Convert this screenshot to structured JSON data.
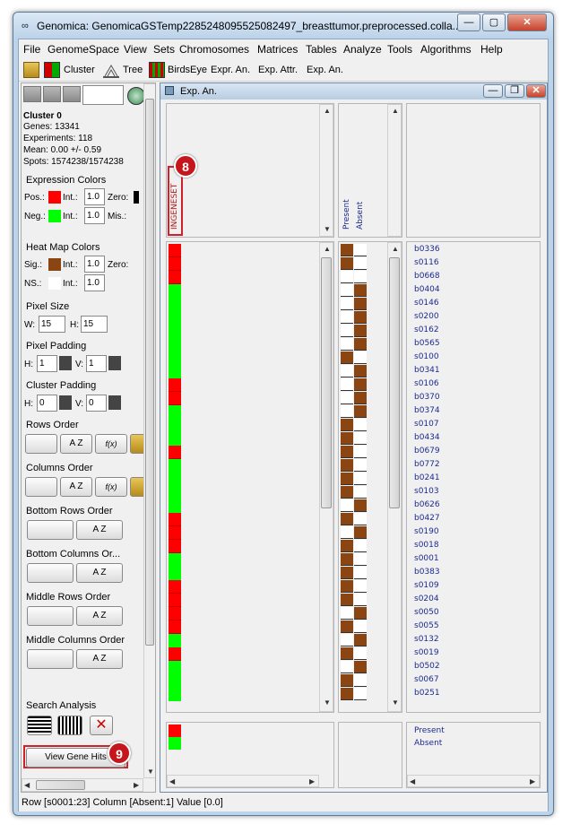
{
  "window": {
    "title": "Genomica: GenomicaGSTemp2285248095525082497_breasttumor.preprocessed.colla...",
    "minimize": "—",
    "maximize": "▢",
    "close": "✕"
  },
  "menu": [
    "File",
    "GenomeSpace",
    "View",
    "Sets",
    "Chromosomes",
    "Matrices",
    "Tables",
    "Analyze",
    "Tools",
    "Algorithms",
    "Help"
  ],
  "toolbar": {
    "cluster": "Cluster",
    "tree": "Tree",
    "birdseye": "BirdsEye",
    "expr_an": "Expr. An.",
    "exp_attr": "Exp. Attr.",
    "exp_an": "Exp. An."
  },
  "cluster_info": {
    "name": "Cluster 0",
    "genes": "Genes: 13341",
    "experiments": "Experiments: 118",
    "mean": "Mean: 0.00 +/- 0.59",
    "spots": "Spots: 1574238/1574238"
  },
  "expression_colors": {
    "title": "Expression Colors",
    "pos": "Pos.:",
    "neg": "Neg.:",
    "int": "Int.:",
    "zero": "Zero:",
    "mis": "Mis.:",
    "pos_int": "1.0",
    "neg_int": "1.0",
    "pos_color": "#ff0000",
    "neg_color": "#00ff00",
    "zero_color": "#000000"
  },
  "heatmap_colors": {
    "title": "Heat Map Colors",
    "sig": "Sig.:",
    "ns": "NS.:",
    "int": "Int.:",
    "zero": "Zero:",
    "sig_int": "1.0",
    "ns_int": "1.0",
    "sig_color": "#8b4513",
    "ns_color": "#ffffff"
  },
  "pixel_size": {
    "title": "Pixel Size",
    "w_label": "W:",
    "h_label": "H:",
    "w": "15",
    "h": "15"
  },
  "pixel_padding": {
    "title": "Pixel Padding",
    "h_label": "H:",
    "v_label": "V:",
    "h": "1",
    "v": "1"
  },
  "cluster_padding": {
    "title": "Cluster Padding",
    "h_label": "H:",
    "v_label": "V:",
    "h": "0",
    "v": "0"
  },
  "rows_order": {
    "title": "Rows Order"
  },
  "columns_order": {
    "title": "Columns Order"
  },
  "bottom_rows_order": {
    "title": "Bottom Rows Order"
  },
  "bottom_columns_order": {
    "title": "Bottom Columns Or..."
  },
  "middle_rows_order": {
    "title": "Middle Rows Order"
  },
  "middle_columns_order": {
    "title": "Middle Columns Order"
  },
  "search_analysis": {
    "title": "Search Analysis"
  },
  "view_gene_hits": "View Gene Hits",
  "internal_frame": {
    "title": "Exp. An."
  },
  "column_header": "INGENESET",
  "attr_columns": [
    "Present",
    "Absent"
  ],
  "row_labels": [
    "b0336",
    "s0116",
    "b0668",
    "b0404",
    "s0146",
    "s0200",
    "s0162",
    "b0565",
    "s0100",
    "b0341",
    "s0106",
    "b0370",
    "b0374",
    "s0107",
    "b0434",
    "b0679",
    "b0772",
    "b0241",
    "s0103",
    "b0626",
    "b0427",
    "s0190",
    "s0018",
    "s0001",
    "b0383",
    "s0109",
    "s0204",
    "s0050",
    "s0055",
    "s0132",
    "s0019",
    "b0502",
    "s0067",
    "b0251"
  ],
  "heat_column": [
    "r",
    "r",
    "r",
    "g",
    "g",
    "g",
    "g",
    "g",
    "g",
    "g",
    "r",
    "r",
    "g",
    "g",
    "g",
    "r",
    "g",
    "g",
    "g",
    "g",
    "r",
    "r",
    "r",
    "g",
    "g",
    "r",
    "r",
    "r",
    "r",
    "g",
    "r",
    "g",
    "g",
    "g"
  ],
  "attr_matrix": [
    [
      1,
      0
    ],
    [
      1,
      0
    ],
    [
      0,
      0
    ],
    [
      0,
      1
    ],
    [
      0,
      1
    ],
    [
      0,
      1
    ],
    [
      0,
      1
    ],
    [
      0,
      1
    ],
    [
      1,
      0
    ],
    [
      0,
      1
    ],
    [
      0,
      1
    ],
    [
      0,
      1
    ],
    [
      0,
      1
    ],
    [
      1,
      0
    ],
    [
      1,
      0
    ],
    [
      1,
      0
    ],
    [
      1,
      0
    ],
    [
      1,
      0
    ],
    [
      1,
      0
    ],
    [
      0,
      1
    ],
    [
      1,
      0
    ],
    [
      0,
      1
    ],
    [
      1,
      0
    ],
    [
      1,
      0
    ],
    [
      1,
      0
    ],
    [
      1,
      0
    ],
    [
      1,
      0
    ],
    [
      0,
      1
    ],
    [
      1,
      0
    ],
    [
      0,
      1
    ],
    [
      1,
      0
    ],
    [
      0,
      1
    ],
    [
      1,
      0
    ],
    [
      1,
      0
    ]
  ],
  "bottom_heat": [
    "r",
    "g"
  ],
  "bottom_labels": [
    "Present",
    "Absent"
  ],
  "annotations": {
    "badge_8": "8",
    "badge_9": "9"
  },
  "status": "Row [s0001:23] Column [Absent:1] Value [0.0]"
}
